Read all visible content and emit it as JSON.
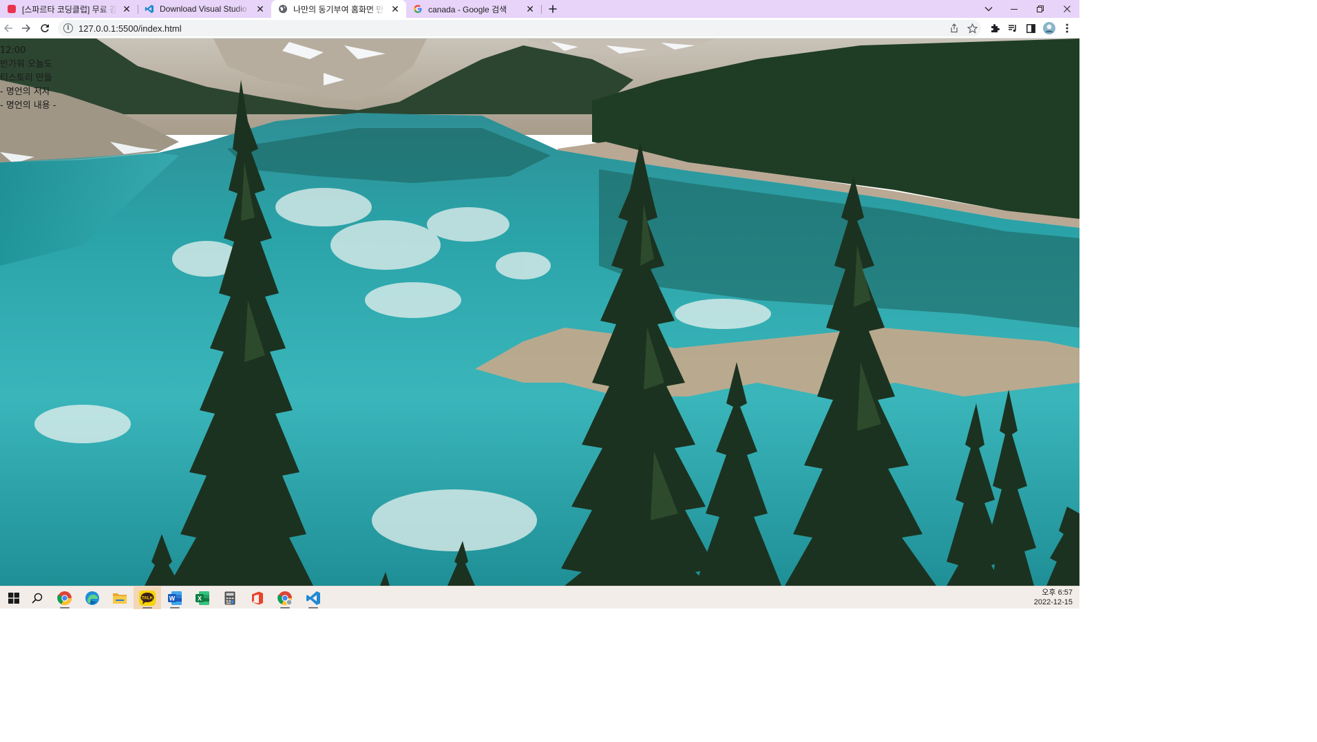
{
  "tabs": [
    {
      "title": "[스파르타 코딩클럽] 무료 강의",
      "icon": "sparta-icon",
      "active": false
    },
    {
      "title": "Download Visual Studio Code -",
      "icon": "vscode-icon",
      "active": false
    },
    {
      "title": "나만의 동기부여 홈화면 만들기",
      "icon": "globe-icon",
      "active": true
    },
    {
      "title": "canada - Google 검색",
      "icon": "google-icon",
      "active": false
    }
  ],
  "toolbar": {
    "url": "127.0.0.1:5500/index.html"
  },
  "page": {
    "clock": "12:00",
    "greeting": "반가워 오늘도",
    "motto": "티스토리 만들",
    "quote_author": "- 명언의 저자",
    "quote_text": "- 명언의 내용 -"
  },
  "taskbar": {
    "apps": [
      "windows-start-icon",
      "search-icon",
      "chrome-icon",
      "edge-icon",
      "file-explorer-icon",
      "kakaotalk-icon",
      "word-icon",
      "excel-icon",
      "calculator-icon",
      "office-icon",
      "chrome-dev-icon",
      "vscode-icon"
    ],
    "kakaotalk_label": "TALK",
    "word_label": "W",
    "excel_label": "X",
    "time": "오후 6:57",
    "date": "2022-12-15"
  },
  "colors": {
    "tabstrip": "#e8d4f8",
    "taskbar": "#f3ede9",
    "vscode_blue": "#1f8ad2"
  }
}
